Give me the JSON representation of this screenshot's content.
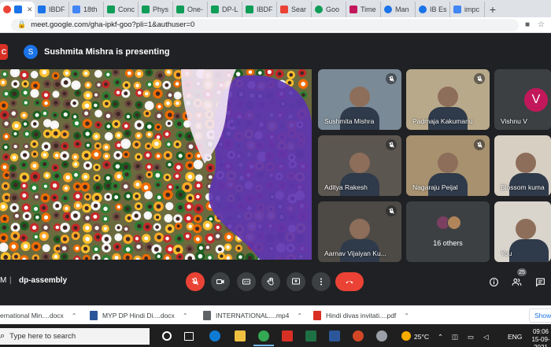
{
  "browser": {
    "tabs": [
      {
        "label": "",
        "color": "#1a73e8",
        "active": true
      },
      {
        "label": "IBDF",
        "color": "#1a73e8"
      },
      {
        "label": "18th",
        "color": "#4285f4"
      },
      {
        "label": "Conc",
        "color": "#0f9d58"
      },
      {
        "label": "Phys",
        "color": "#0f9d58"
      },
      {
        "label": "One-",
        "color": "#0f9d58"
      },
      {
        "label": "DP-L",
        "color": "#0f9d58"
      },
      {
        "label": "IBDF",
        "color": "#0f9d58"
      },
      {
        "label": "Sear",
        "color": "#ea4335"
      },
      {
        "label": "Goo",
        "color": "#0f9d58"
      },
      {
        "label": "Time",
        "color": "#c2185b"
      },
      {
        "label": "Man",
        "color": "#1a73e8"
      },
      {
        "label": "IB Es",
        "color": "#1a73e8"
      },
      {
        "label": "impc",
        "color": "#4285f4"
      }
    ],
    "new_tab": "+",
    "url": "meet.google.com/gha-ipkf-goo?pli=1&authuser=0"
  },
  "banner": {
    "edge_letter": "C",
    "presenter_initial": "S",
    "presenter_text": "Sushmita Mishra is presenting"
  },
  "participants": [
    {
      "name": "Sushmita Mishra",
      "muted": true,
      "bg": "#7a8a96"
    },
    {
      "name": "Padmaja Kakumanu",
      "muted": true,
      "bg": "#b8a98a"
    },
    {
      "name": "Vishnu V",
      "muted": false,
      "bg": "#3c4043",
      "initial": "V"
    },
    {
      "name": "Aditya Rakesh",
      "muted": true,
      "bg": "#5c5650"
    },
    {
      "name": "Nagaraju Peijal",
      "muted": true,
      "bg": "#a7916f"
    },
    {
      "name": "Blossom kuma",
      "muted": false,
      "bg": "#d8cfc3"
    },
    {
      "name": "Aarnav Vijaiyan Ku...",
      "muted": true,
      "bg": "#4d4a45"
    },
    {
      "name": "16 others",
      "muted": false,
      "bg": "#3c4043"
    },
    {
      "name": "You",
      "muted": false,
      "bg": "#d9d4cc"
    }
  ],
  "controls": {
    "time_fragment": "M",
    "separator": "|",
    "meeting_code": "dp-assembly",
    "participant_count": "25"
  },
  "downloads": [
    {
      "name": "ernational Min....docx",
      "color": "#2b579a"
    },
    {
      "name": "MYP DP Hindi Di....docx",
      "color": "#2b579a"
    },
    {
      "name": "INTERNATIONAL....mp4",
      "color": "#5f6368"
    },
    {
      "name": "Hindi divas invitati....pdf",
      "color": "#d93025"
    }
  ],
  "downloads_show_all": "Show",
  "taskbar": {
    "search_placeholder": "Type here to search",
    "weather": "25°C",
    "language": "ENG",
    "time": "09:06",
    "date": "15-09-2021"
  }
}
